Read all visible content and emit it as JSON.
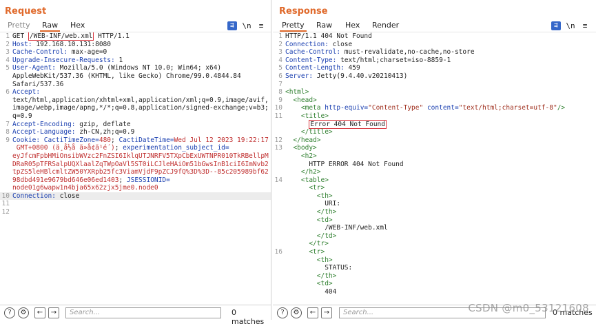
{
  "request": {
    "title": "Request",
    "tabs": [
      "Pretty",
      "Raw",
      "Hex"
    ],
    "lines": [
      {
        "n": "1",
        "parts": [
          {
            "t": "GET "
          },
          {
            "t": "/WEB-INF/web.xml",
            "box": true
          },
          {
            "t": " HTTP/1.1"
          }
        ]
      },
      {
        "n": "2",
        "parts": [
          {
            "t": "Host:",
            "c": "k"
          },
          {
            "t": " 192.168.10.131:8080"
          }
        ]
      },
      {
        "n": "3",
        "parts": [
          {
            "t": "Cache-Control:",
            "c": "k"
          },
          {
            "t": " max-age=0"
          }
        ]
      },
      {
        "n": "4",
        "parts": [
          {
            "t": "Upgrade-Insecure-Requests:",
            "c": "k"
          },
          {
            "t": " 1"
          }
        ]
      },
      {
        "n": "5",
        "parts": [
          {
            "t": "User-Agent:",
            "c": "k"
          },
          {
            "t": " Mozilla/5.0 (Windows NT 10.0; Win64; x64)"
          }
        ]
      },
      {
        "n": "",
        "parts": [
          {
            "t": "AppleWebKit/537.36 (KHTML, like Gecko) Chrome/99.0.4844.84"
          }
        ]
      },
      {
        "n": "",
        "parts": [
          {
            "t": "Safari/537.36"
          }
        ]
      },
      {
        "n": "6",
        "parts": [
          {
            "t": "Accept:",
            "c": "k"
          }
        ]
      },
      {
        "n": "",
        "parts": [
          {
            "t": "text/html,application/xhtml+xml,application/xml;q=0.9,image/avif,"
          }
        ]
      },
      {
        "n": "",
        "parts": [
          {
            "t": "image/webp,image/apng,*/*;q=0.8,application/signed-exchange;v=b3;"
          }
        ]
      },
      {
        "n": "",
        "parts": [
          {
            "t": "q=0.9"
          }
        ]
      },
      {
        "n": "7",
        "parts": [
          {
            "t": "Accept-Encoding:",
            "c": "k"
          },
          {
            "t": " gzip, deflate"
          }
        ]
      },
      {
        "n": "8",
        "parts": [
          {
            "t": "Accept-Language:",
            "c": "k"
          },
          {
            "t": " zh-CN,zh;q=0.9"
          }
        ]
      },
      {
        "n": "9",
        "parts": [
          {
            "t": "Cookie:",
            "c": "k"
          },
          {
            "t": " CactiTimeZone=",
            "c": "k"
          },
          {
            "t": "480",
            "c": "r"
          },
          {
            "t": "; "
          },
          {
            "t": "CactiDateTime=",
            "c": "k"
          },
          {
            "t": "Wed Jul 12 2023 19:22:17",
            "c": "r"
          }
        ]
      },
      {
        "n": "",
        "parts": [
          {
            "t": " GMT+0800 (ä¸­å½å ä»å¢ä¹é´)",
            "c": "r"
          },
          {
            "t": "; "
          },
          {
            "t": "experimentation_subject_id=",
            "c": "k"
          }
        ]
      },
      {
        "n": "",
        "parts": [
          {
            "t": "eyJfcmFpbHMiOnsibWVzc2FnZSI6IklqUTJNRFV5TXpCbExUWTNPR010TkRBellpM",
            "c": "r"
          }
        ]
      },
      {
        "n": "",
        "parts": [
          {
            "t": "DRaR05pTFRSalpUQXlaalZqTWpOaVl5ST0iLCJleHAiOm51bGwsInB1ciI6ImNvb2",
            "c": "r"
          }
        ]
      },
      {
        "n": "",
        "parts": [
          {
            "t": "tpZS5leHBlcmltZW50YXRpb25fc3ViamVjdF9pZCJ9fQ%3D%3D--85c205989bf62",
            "c": "r"
          }
        ]
      },
      {
        "n": "",
        "parts": [
          {
            "t": "98dbd491e9679bd646e06ed1403",
            "c": "r"
          },
          {
            "t": "; "
          },
          {
            "t": "JSESSIONID=",
            "c": "k"
          }
        ]
      },
      {
        "n": "",
        "parts": [
          {
            "t": "node01g6wapw1n4bja65x62zjx5jme0.node0",
            "c": "r"
          }
        ]
      },
      {
        "n": "10",
        "hl": true,
        "parts": [
          {
            "t": "Connection:",
            "c": "k"
          },
          {
            "t": " close"
          }
        ]
      },
      {
        "n": "11",
        "parts": []
      },
      {
        "n": "12",
        "parts": []
      }
    ],
    "search_placeholder": "Search...",
    "matches": "0 matches"
  },
  "response": {
    "title": "Response",
    "tabs": [
      "Pretty",
      "Raw",
      "Hex",
      "Render"
    ],
    "lines": [
      {
        "n": "1",
        "parts": [
          {
            "t": "HTTP/1.1 404 Not Found"
          }
        ]
      },
      {
        "n": "2",
        "parts": [
          {
            "t": "Connection:",
            "c": "k"
          },
          {
            "t": " close"
          }
        ]
      },
      {
        "n": "3",
        "parts": [
          {
            "t": "Cache-Control:",
            "c": "k"
          },
          {
            "t": " must-revalidate,no-cache,no-store"
          }
        ]
      },
      {
        "n": "4",
        "parts": [
          {
            "t": "Content-Type:",
            "c": "k"
          },
          {
            "t": " text/html;charset=iso-8859-1"
          }
        ]
      },
      {
        "n": "5",
        "parts": [
          {
            "t": "Content-Length:",
            "c": "k"
          },
          {
            "t": " 459"
          }
        ]
      },
      {
        "n": "6",
        "parts": [
          {
            "t": "Server:",
            "c": "k"
          },
          {
            "t": " Jetty(9.4.40.v20210413)"
          }
        ]
      },
      {
        "n": "7",
        "parts": []
      },
      {
        "n": "8",
        "parts": [
          {
            "t": "<html>",
            "c": "tag"
          }
        ]
      },
      {
        "n": "9",
        "parts": [
          {
            "t": "  "
          },
          {
            "t": "<head>",
            "c": "tag"
          }
        ]
      },
      {
        "n": "10",
        "parts": [
          {
            "t": "    "
          },
          {
            "t": "<meta ",
            "c": "tag"
          },
          {
            "t": "http-equiv=",
            "c": "attr"
          },
          {
            "t": "\"Content-Type\" ",
            "c": "aval"
          },
          {
            "t": "content=",
            "c": "attr"
          },
          {
            "t": "\"text/html;charset=utf-8\"",
            "c": "aval"
          },
          {
            "t": "/>",
            "c": "tag"
          }
        ]
      },
      {
        "n": "11",
        "parts": [
          {
            "t": "    "
          },
          {
            "t": "<title>",
            "c": "tag"
          }
        ]
      },
      {
        "n": "",
        "parts": [
          {
            "t": "      "
          },
          {
            "t": "Error 404 Not Found",
            "box": true
          }
        ]
      },
      {
        "n": "",
        "parts": [
          {
            "t": "    "
          },
          {
            "t": "</title>",
            "c": "tag"
          }
        ]
      },
      {
        "n": "12",
        "parts": [
          {
            "t": "  "
          },
          {
            "t": "</head>",
            "c": "tag"
          }
        ]
      },
      {
        "n": "13",
        "parts": [
          {
            "t": "  "
          },
          {
            "t": "<body>",
            "c": "tag"
          }
        ]
      },
      {
        "n": "",
        "parts": [
          {
            "t": "    "
          },
          {
            "t": "<h2>",
            "c": "tag"
          }
        ]
      },
      {
        "n": "",
        "parts": [
          {
            "t": "      HTTP ERROR 404 Not Found"
          }
        ]
      },
      {
        "n": "",
        "parts": [
          {
            "t": "    "
          },
          {
            "t": "</h2>",
            "c": "tag"
          }
        ]
      },
      {
        "n": "14",
        "parts": [
          {
            "t": "    "
          },
          {
            "t": "<table>",
            "c": "tag"
          }
        ]
      },
      {
        "n": "",
        "parts": [
          {
            "t": "      "
          },
          {
            "t": "<tr>",
            "c": "tag"
          }
        ]
      },
      {
        "n": "",
        "parts": [
          {
            "t": "        "
          },
          {
            "t": "<th>",
            "c": "tag"
          }
        ]
      },
      {
        "n": "",
        "parts": [
          {
            "t": "          URI:"
          }
        ]
      },
      {
        "n": "",
        "parts": [
          {
            "t": "        "
          },
          {
            "t": "</th>",
            "c": "tag"
          }
        ]
      },
      {
        "n": "",
        "parts": [
          {
            "t": "        "
          },
          {
            "t": "<td>",
            "c": "tag"
          }
        ]
      },
      {
        "n": "",
        "parts": [
          {
            "t": "          /WEB-INF/web.xml"
          }
        ]
      },
      {
        "n": "",
        "parts": [
          {
            "t": "        "
          },
          {
            "t": "</td>",
            "c": "tag"
          }
        ]
      },
      {
        "n": "",
        "parts": [
          {
            "t": "      "
          },
          {
            "t": "</tr>",
            "c": "tag"
          }
        ]
      },
      {
        "n": "16",
        "parts": [
          {
            "t": "      "
          },
          {
            "t": "<tr>",
            "c": "tag"
          }
        ]
      },
      {
        "n": "",
        "parts": [
          {
            "t": "        "
          },
          {
            "t": "<th>",
            "c": "tag"
          }
        ]
      },
      {
        "n": "",
        "parts": [
          {
            "t": "          STATUS:"
          }
        ]
      },
      {
        "n": "",
        "parts": [
          {
            "t": "        "
          },
          {
            "t": "</th>",
            "c": "tag"
          }
        ]
      },
      {
        "n": "",
        "parts": [
          {
            "t": "        "
          },
          {
            "t": "<td>",
            "c": "tag"
          }
        ]
      },
      {
        "n": "",
        "parts": [
          {
            "t": "          404"
          }
        ]
      }
    ],
    "search_placeholder": "Search...",
    "matches": "0 matches"
  },
  "icons": {
    "word_wrap": "wrap-icon",
    "newline": "\\n",
    "menu": "≡",
    "help": "?",
    "prev": "←",
    "next": "→"
  },
  "watermark": "CSDN @m0_53121608",
  "colors": {
    "accent": "#e06a2c",
    "key": "#1a3fb0",
    "value": "#c03030",
    "box": "#d9363e",
    "selected": "#3567c9"
  }
}
